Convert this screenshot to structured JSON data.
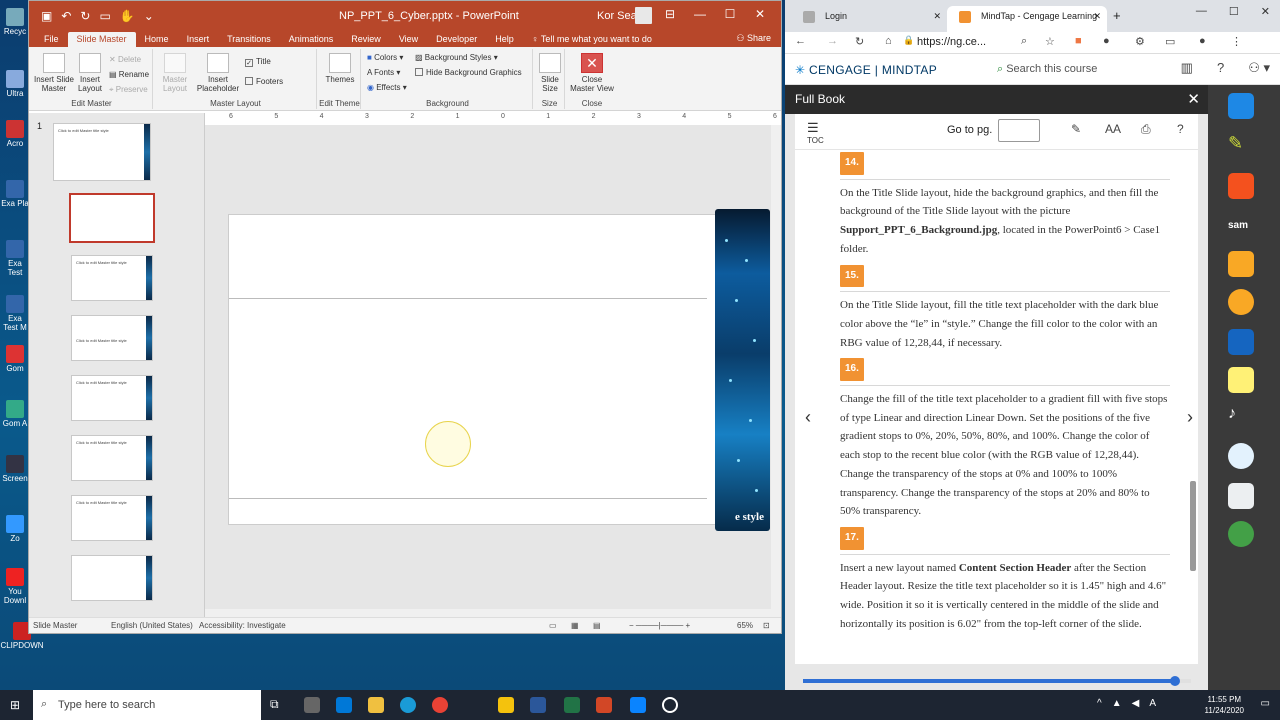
{
  "desktop": {
    "icons": [
      "Recyc",
      "Ultra",
      "Acro",
      "Exa Pla",
      "Exa Test",
      "Exa Test M",
      "Gom",
      "Gom A",
      "Screen",
      "Zo",
      "You Downl",
      "CLIPDOWN"
    ]
  },
  "ppt": {
    "title": "NP_PPT_6_Cyber.pptx  -  PowerPoint",
    "user": "Kor Sean",
    "tabs": [
      "File",
      "Slide Master",
      "Home",
      "Insert",
      "Transitions",
      "Animations",
      "Review",
      "View",
      "Developer",
      "Help"
    ],
    "tell_me": "Tell me what you want to do",
    "share": "Share",
    "ribbon": {
      "insert_slide_master": "Insert Slide Master",
      "insert_layout": "Insert Layout",
      "delete": "Delete",
      "rename": "Rename",
      "preserve": "Preserve",
      "edit_master": "Edit Master",
      "master_layout_btn": "Master Layout",
      "insert_placeholder": "Insert Placeholder",
      "title_chk": "Title",
      "footers_chk": "Footers",
      "master_layout_grp": "Master Layout",
      "themes": "Themes",
      "edit_theme": "Edit Theme",
      "colors": "Colors",
      "fonts": "Fonts",
      "effects": "Effects",
      "bg_styles": "Background Styles",
      "hide_bg": "Hide Background Graphics",
      "background": "Background",
      "slide_size": "Slide Size",
      "size": "Size",
      "close_master": "Close Master View",
      "close": "Close"
    },
    "thumb_number": "1",
    "thumb_text": "Click to edit Master title style",
    "ruler": [
      "6",
      "5",
      "4",
      "3",
      "2",
      "1",
      "0",
      "1",
      "2",
      "3",
      "4",
      "5",
      "6"
    ],
    "slide_title_fragment": "e style",
    "status": {
      "view": "Slide Master",
      "lang": "English (United States)",
      "access": "Accessibility: Investigate",
      "zoom": "65%"
    }
  },
  "browser": {
    "tabs": [
      {
        "label": "Login"
      },
      {
        "label": "MindTap - Cengage Learning"
      }
    ],
    "url": "https://ng.ce...",
    "brand": "CENGAGE",
    "product": "MINDTAP",
    "search_placeholder": "Search this course",
    "panel_title": "Full Book",
    "goto": "Go to pg.",
    "toc": "TOC",
    "steps": [
      {
        "num": "14.",
        "text": "On the Title Slide layout, hide the background graphics, and then fill the background of the Title Slide layout with the picture ",
        "bold": "Support_PPT_6_Background.jpg",
        "after": ", located in the PowerPoint6 > Case1 folder."
      },
      {
        "num": "15.",
        "text": "On the Title Slide layout, fill the title text placeholder with the dark blue color above the “le” in “style.” Change the fill color to the color with an RBG value of 12,28,44, if necessary.",
        "bold": "",
        "after": ""
      },
      {
        "num": "16.",
        "text": "Change the fill of the title text placeholder to a gradient fill with five stops of type Linear and direction Linear Down. Set the positions of the five gradient stops to 0%, 20%, 50%, 80%, and 100%. Change the color of each stop to the recent blue color (with the RGB value of 12,28,44). Change the transparency of the stops at 0% and 100% to 100% transparency. Change the transparency of the stops at 20% and 80% to 50% transparency.",
        "bold": "",
        "after": ""
      },
      {
        "num": "17.",
        "text": "Insert a new layout named ",
        "bold": "Content Section Header",
        "after": " after the Section Header layout. Resize the title text placeholder so it is 1.45\" high and 4.6\" wide. Position it so it is vertically centered in the middle of the slide and horizontally its position is 6.02\" from the top-left corner of the slide."
      }
    ],
    "progress": 0.96
  },
  "taskbar": {
    "search": "Type here to search",
    "time": "11:55 PM",
    "date": "11/24/2020"
  }
}
